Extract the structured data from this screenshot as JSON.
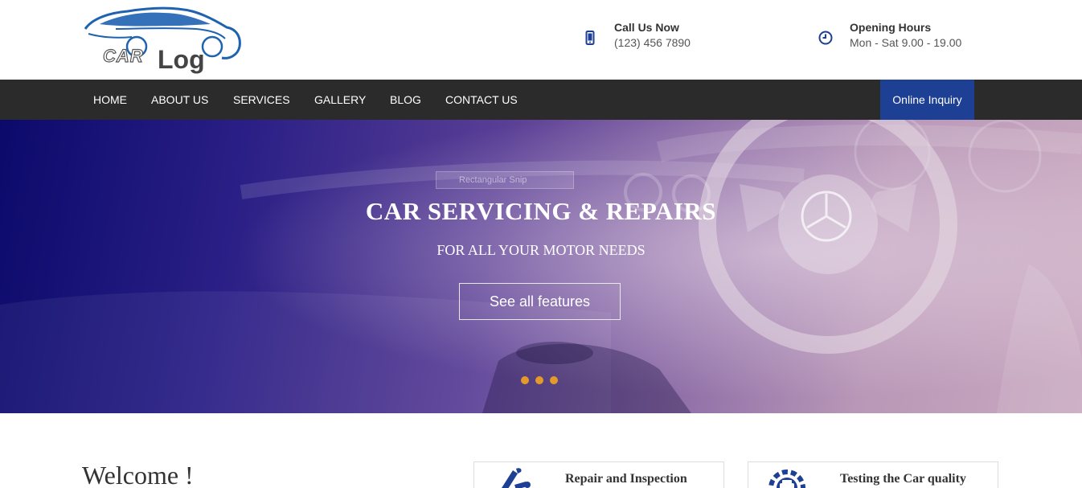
{
  "logo": {
    "car": "CAR",
    "log": "Log"
  },
  "header": {
    "phone": {
      "title": "Call Us Now",
      "value": "(123) 456 7890",
      "icon": "mobile-phone-icon"
    },
    "hours": {
      "title": "Opening Hours",
      "value": "Mon - Sat 9.00 - 19.00",
      "icon": "clock-icon"
    }
  },
  "nav": {
    "items": [
      {
        "label": "HOME"
      },
      {
        "label": "ABOUT US"
      },
      {
        "label": "SERVICES"
      },
      {
        "label": "GALLERY"
      },
      {
        "label": "BLOG"
      },
      {
        "label": "CONTACT US"
      }
    ],
    "inquiry": "Online Inquiry"
  },
  "hero": {
    "label": "Rectangular Snip",
    "title": "CAR SERVICING & REPAIRS",
    "subtitle": "FOR ALL YOUR MOTOR NEEDS",
    "button": "See all features",
    "slides": 3
  },
  "content": {
    "welcome": "Welcome !",
    "cards": [
      {
        "title": "Repair and Inspection",
        "icon": "tools-icon"
      },
      {
        "title": "Testing the Car quality",
        "icon": "gear-car-icon"
      }
    ]
  },
  "colors": {
    "nav_bg": "#2b2b2b",
    "accent": "#1d3f94",
    "dot": "#e39a2a",
    "icon": "#1d3f94"
  }
}
